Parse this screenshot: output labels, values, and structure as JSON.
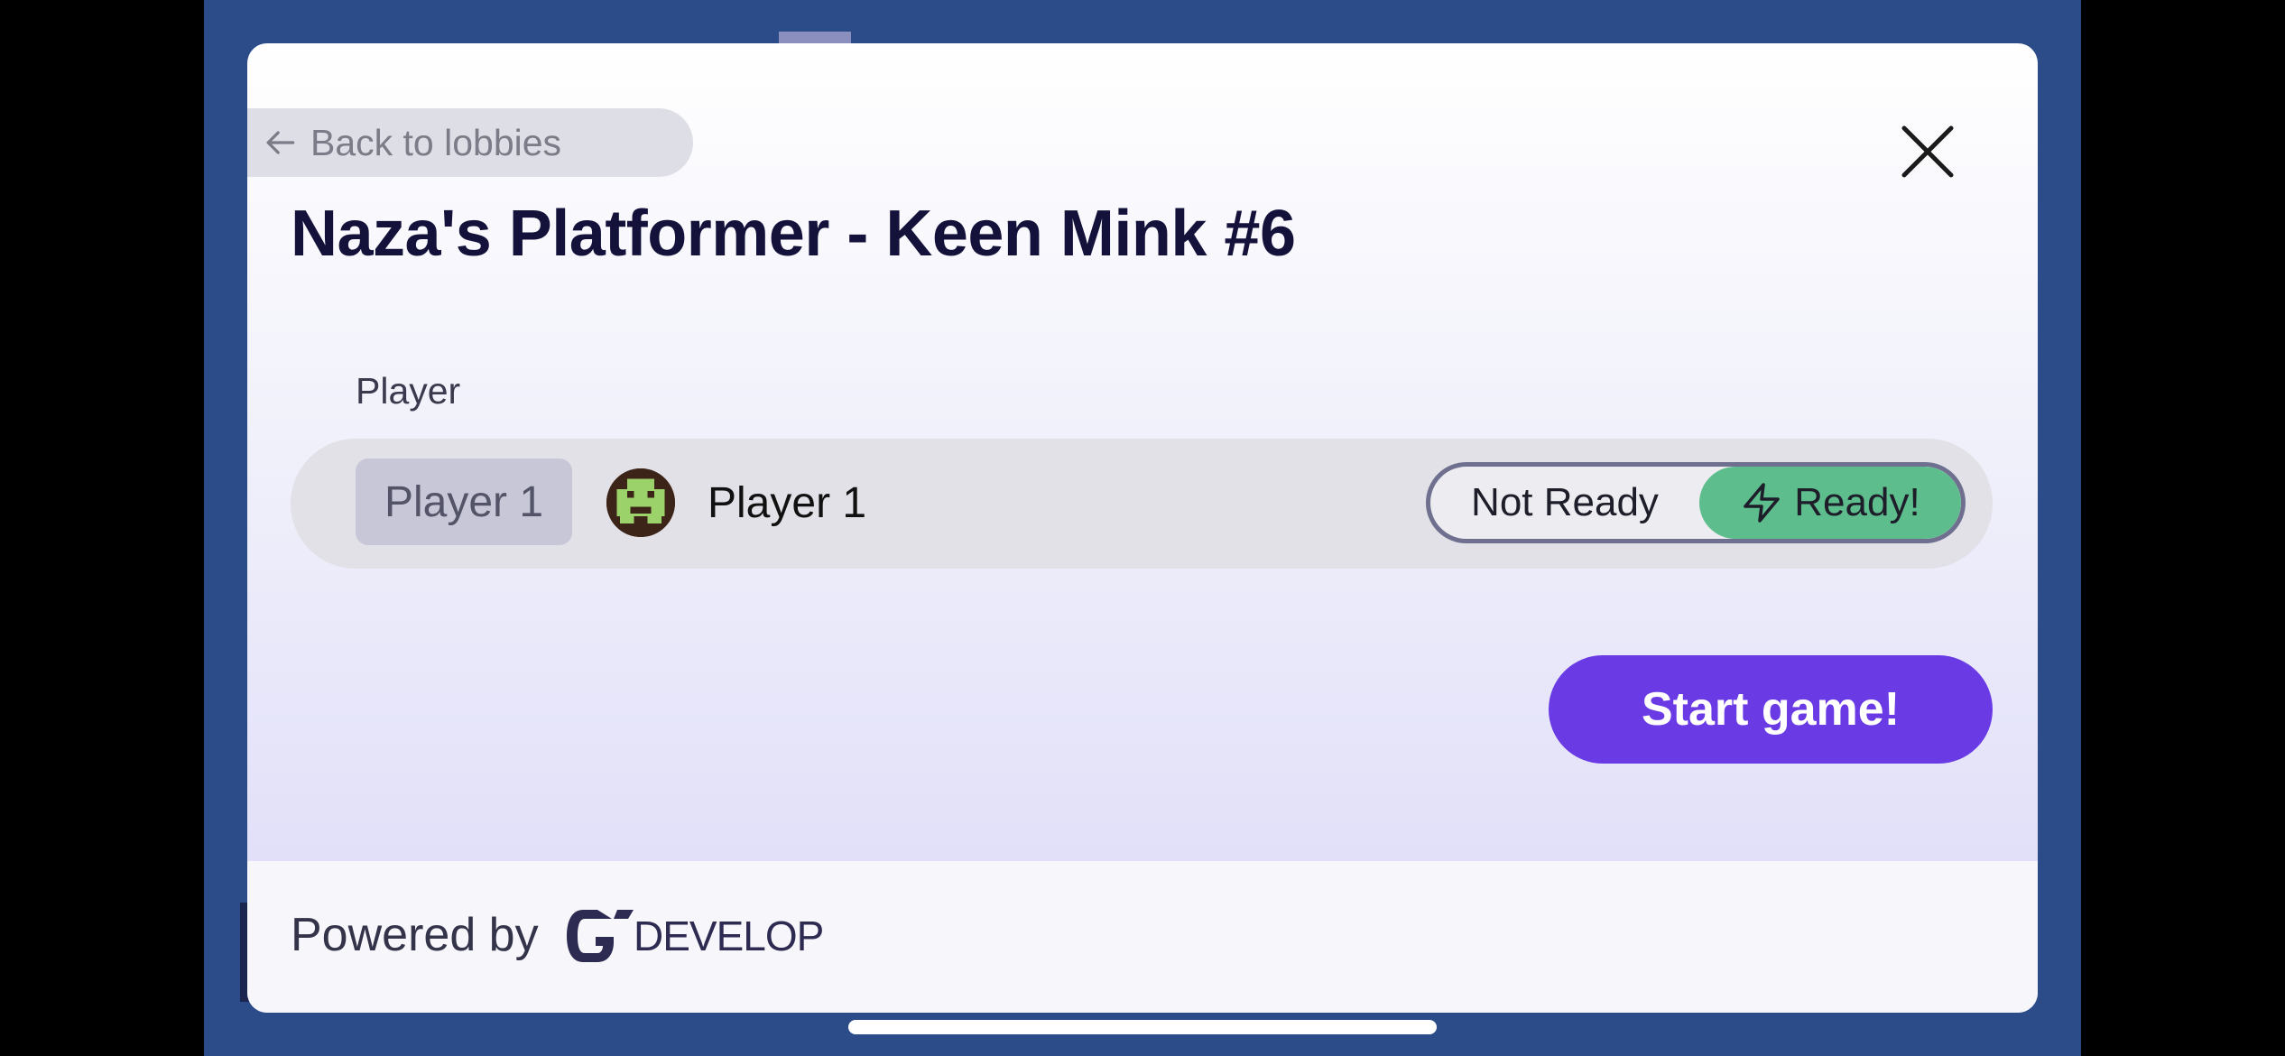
{
  "modal": {
    "back_label": "Back to lobbies",
    "title": "Naza's Platformer - Keen Mink #6"
  },
  "players": {
    "column_header": "Player",
    "rows": [
      {
        "slot": "Player 1",
        "name": "Player 1",
        "status_options": [
          "Not Ready",
          "Ready!"
        ],
        "selected_status": "Ready!"
      }
    ]
  },
  "actions": {
    "start_label": "Start game!"
  },
  "footer": {
    "powered_by": "Powered by",
    "logo_text": "DEVELOP"
  },
  "icons": [
    "arrow-left-icon",
    "close-icon",
    "lightning-bolt-icon",
    "player-avatar",
    "gdevelop-logo"
  ],
  "colors": {
    "accent": "#6a3be5",
    "ready_green": "#5ebd8d",
    "title": "#14123a",
    "game_background": "#2c4c89"
  }
}
